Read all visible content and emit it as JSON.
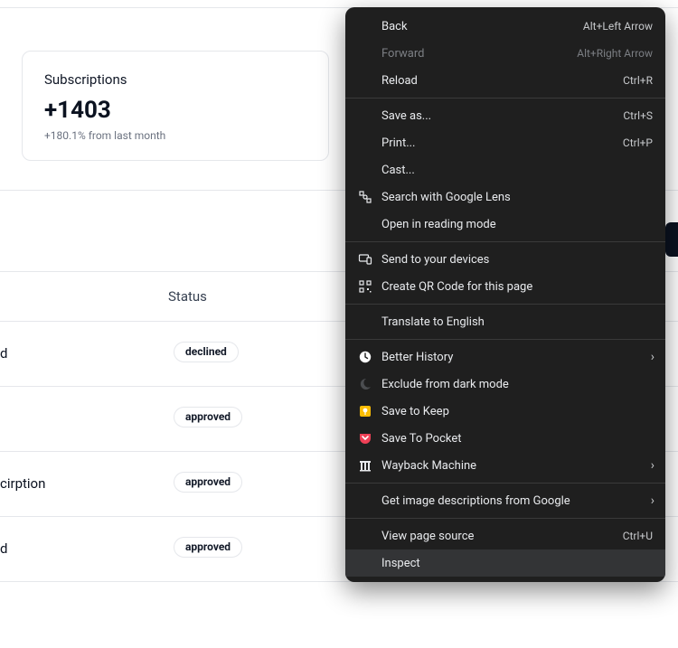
{
  "card": {
    "title": "Subscriptions",
    "value": "+1403",
    "subtext": "+180.1% from last month"
  },
  "table": {
    "header": {
      "status": "Status"
    },
    "rows": [
      {
        "text_fragment": "d",
        "status": "declined"
      },
      {
        "text_fragment": "",
        "status": "approved"
      },
      {
        "text_fragment": "cirption",
        "status": "approved"
      },
      {
        "text_fragment": "d",
        "status": "approved"
      }
    ]
  },
  "context_menu": {
    "items": [
      {
        "label": "Back",
        "shortcut": "Alt+Left Arrow",
        "disabled": false
      },
      {
        "label": "Forward",
        "shortcut": "Alt+Right Arrow",
        "disabled": true
      },
      {
        "label": "Reload",
        "shortcut": "Ctrl+R"
      },
      {
        "sep": true
      },
      {
        "label": "Save as...",
        "shortcut": "Ctrl+S"
      },
      {
        "label": "Print...",
        "shortcut": "Ctrl+P"
      },
      {
        "label": "Cast..."
      },
      {
        "label": "Search with Google Lens",
        "icon": "lens"
      },
      {
        "label": "Open in reading mode"
      },
      {
        "sep": true
      },
      {
        "label": "Send to your devices",
        "icon": "devices"
      },
      {
        "label": "Create QR Code for this page",
        "icon": "qr"
      },
      {
        "sep": true
      },
      {
        "label": "Translate to English"
      },
      {
        "sep": true
      },
      {
        "label": "Better History",
        "icon": "clock",
        "submenu": true
      },
      {
        "label": "Exclude from dark mode",
        "icon": "moon"
      },
      {
        "label": "Save to Keep",
        "icon": "keep"
      },
      {
        "label": "Save To Pocket",
        "icon": "pocket"
      },
      {
        "label": "Wayback Machine",
        "icon": "archive",
        "submenu": true
      },
      {
        "sep": true
      },
      {
        "label": "Get image descriptions from Google",
        "submenu": true
      },
      {
        "sep": true
      },
      {
        "label": "View page source",
        "shortcut": "Ctrl+U"
      },
      {
        "label": "Inspect",
        "highlight": true
      }
    ]
  }
}
